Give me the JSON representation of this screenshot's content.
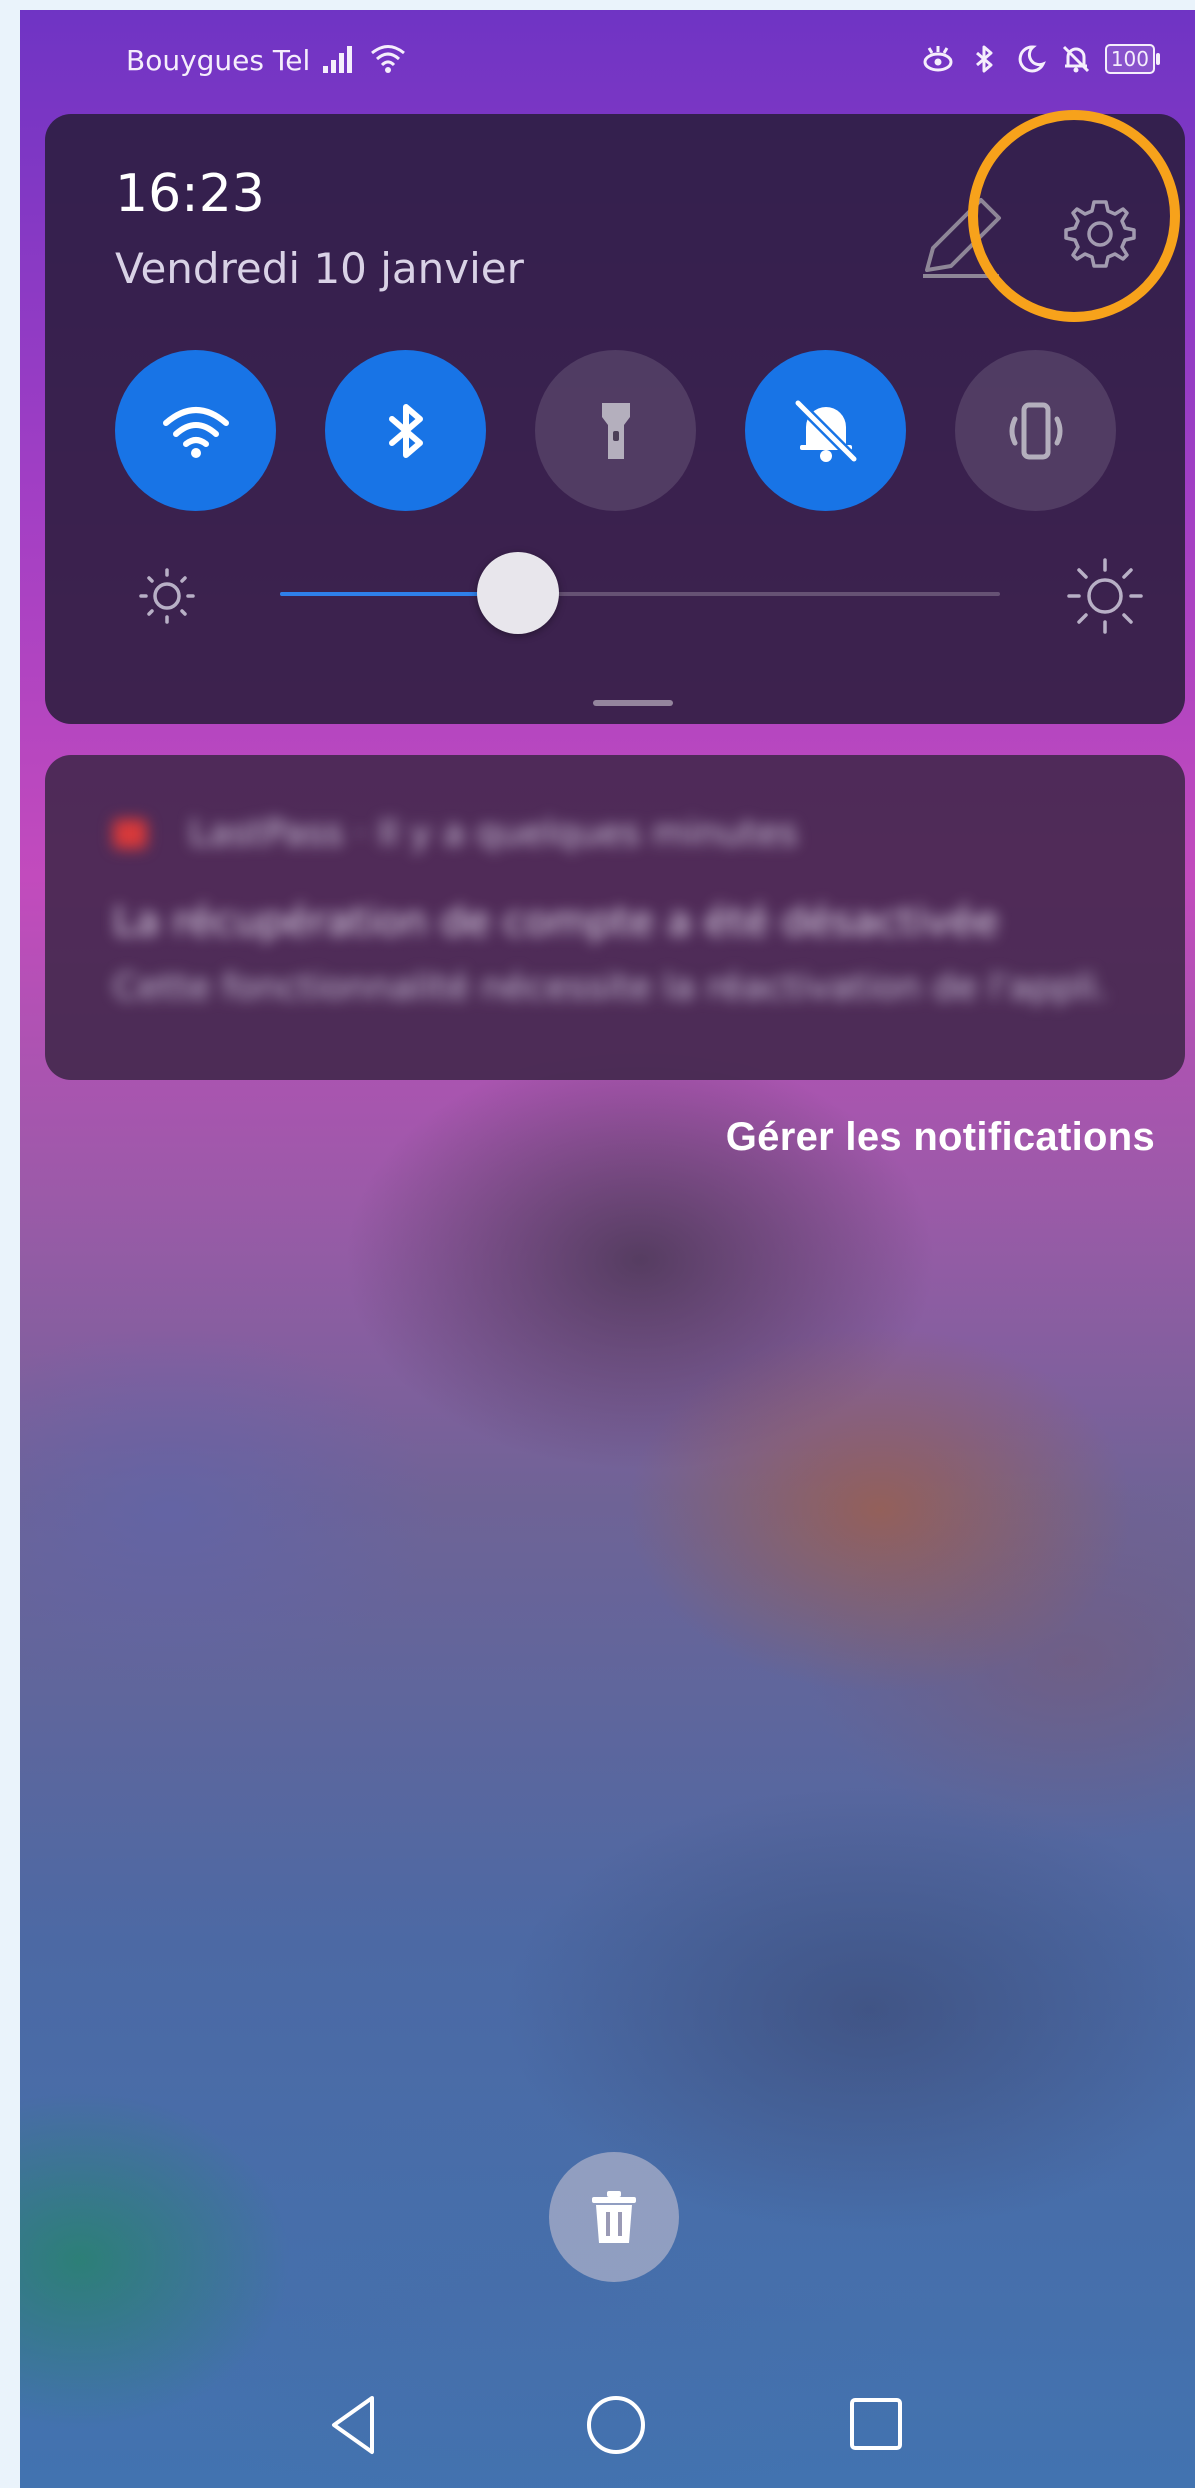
{
  "status_bar": {
    "carrier": "Bouygues Tel",
    "battery": "100",
    "icons": [
      "signal-icon",
      "wifi-icon",
      "eye-comfort-icon",
      "bluetooth-icon",
      "moon-icon",
      "bell-off-icon",
      "battery-icon"
    ]
  },
  "quick_settings": {
    "time": "16:23",
    "date": "Vendredi 10 janvier",
    "tiles": [
      {
        "name": "wifi",
        "icon": "wifi-icon",
        "state": "on"
      },
      {
        "name": "bluetooth",
        "icon": "bluetooth-icon",
        "state": "on"
      },
      {
        "name": "flashlight",
        "icon": "flashlight-icon",
        "state": "off"
      },
      {
        "name": "silent",
        "icon": "bell-off-icon",
        "state": "on"
      },
      {
        "name": "vibrate",
        "icon": "vibrate-icon",
        "state": "off"
      }
    ],
    "brightness": 0.33,
    "highlight_color": "#f7a21b",
    "accent_color": "#1874e6"
  },
  "notification": {
    "app": "LastPass · Il y a quelques minutes",
    "line1": "La récupération de compte a été désactivée",
    "line2": "Cette fonctionnalité nécessite la réactivation de l'appli."
  },
  "manage_notifications": "Gérer les notifications",
  "nav": {
    "icons": [
      "back-icon",
      "home-icon",
      "recents-icon"
    ]
  }
}
